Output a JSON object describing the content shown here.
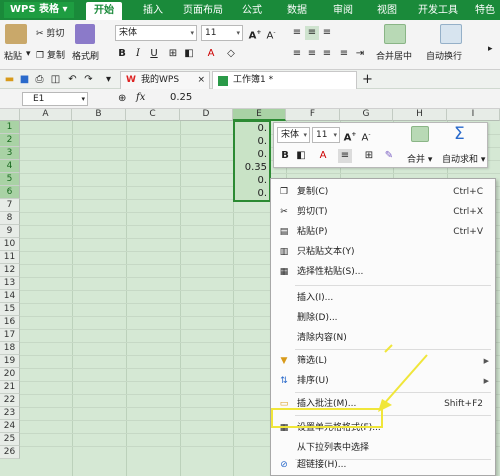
{
  "app": {
    "name": "WPS 表格",
    "menu_tabs": [
      "开始",
      "插入",
      "页面布局",
      "公式",
      "数据",
      "审阅",
      "视图",
      "开发工具",
      "特色"
    ]
  },
  "ribbon": {
    "paste": "粘贴",
    "cut": "剪切",
    "copy": "复制",
    "format_painter": "格式刷",
    "font_name": "宋体",
    "font_size": "11",
    "merge_center": "合并居中",
    "auto_wrap": "自动换行"
  },
  "tabs": {
    "wps": "我的WPS",
    "workbook": "工作簿1 *",
    "add": "+"
  },
  "formula": {
    "cell_ref": "E1",
    "fx": "fx",
    "value": "0.25"
  },
  "sheet": {
    "columns": [
      "A",
      "B",
      "C",
      "D",
      "E",
      "F",
      "G",
      "H",
      "I"
    ],
    "rows": [
      "1",
      "2",
      "3",
      "4",
      "5",
      "6",
      "7",
      "8",
      "9",
      "10",
      "11",
      "12",
      "13",
      "14",
      "15",
      "16",
      "17",
      "18",
      "19",
      "20",
      "21",
      "22",
      "23",
      "24",
      "25",
      "26"
    ],
    "e_values": [
      "0.",
      "0.",
      "0.",
      "0.35",
      "0.",
      "0."
    ]
  },
  "mini_toolbar": {
    "font_name": "宋体",
    "font_size": "11",
    "merge": "合并",
    "autosum": "自动求和"
  },
  "context_menu": {
    "copy": {
      "label": "复制(C)",
      "shortcut": "Ctrl+C"
    },
    "cut": {
      "label": "剪切(T)",
      "shortcut": "Ctrl+X"
    },
    "paste": {
      "label": "粘贴(P)",
      "shortcut": "Ctrl+V"
    },
    "paste_text": {
      "label": "只粘贴文本(Y)"
    },
    "paste_special": {
      "label": "选择性粘贴(S)..."
    },
    "insert": {
      "label": "插入(I)..."
    },
    "delete": {
      "label": "删除(D)..."
    },
    "clear": {
      "label": "清除内容(N)"
    },
    "filter": {
      "label": "筛选(L)"
    },
    "sort": {
      "label": "排序(U)"
    },
    "comment": {
      "label": "插入批注(M)...",
      "shortcut": "Shift+F2"
    },
    "format_cells": {
      "label": "设置单元格格式(F)..."
    },
    "dropdown_pick": {
      "label": "从下拉列表中选择"
    },
    "hyperlink": {
      "label": "超链接(H)..."
    }
  },
  "colors": {
    "accent": "#1a8a3a",
    "grid": "#d5e8d4",
    "highlight": "#f0e63a"
  }
}
